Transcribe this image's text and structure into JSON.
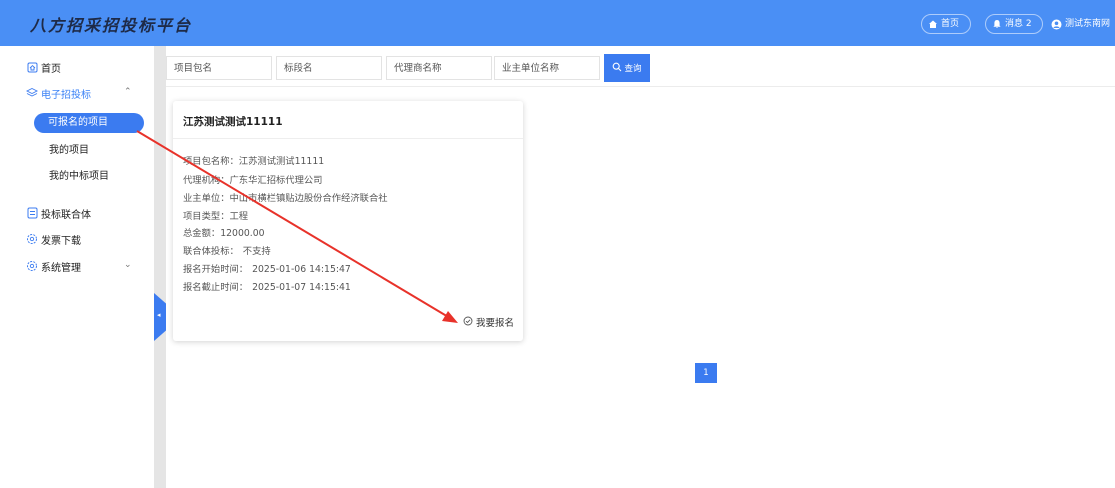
{
  "header": {
    "logo_text": "八方招采招投标平台",
    "home_label": "首页",
    "messages_label": "消息 2",
    "user_name": "测试东南网"
  },
  "sidebar": {
    "home": "首页",
    "etender": "电子招投标",
    "sub_items": [
      "可报名的项目",
      "我的项目",
      "我的中标项目"
    ],
    "consortium": "投标联合体",
    "invoice": "发票下载",
    "system": "系统管理"
  },
  "search": {
    "package_placeholder": "项目包名",
    "section_placeholder": "标段名",
    "agent_placeholder": "代理商名称",
    "owner_placeholder": "业主单位名称",
    "query_label": "查询"
  },
  "card": {
    "title": "江苏测试测试11111",
    "fields": [
      {
        "label": "项目包名称：",
        "value": "江苏测试测试11111"
      },
      {
        "label": "代理机构：",
        "value": "广东华汇招标代理公司"
      },
      {
        "label": "业主单位：",
        "value": "中山市横栏镇贴边股份合作经济联合社"
      },
      {
        "label": "项目类型：",
        "value": "工程"
      },
      {
        "label": "总金额：",
        "value": "12000.00"
      },
      {
        "label": "联合体投标：",
        "value": "不支持"
      },
      {
        "label": "报名开始时间：",
        "value": "2025-01-06 14:15:47"
      },
      {
        "label": "报名截止时间：",
        "value": "2025-01-07 14:15:41"
      }
    ],
    "signup_label": "我要报名"
  },
  "pagination": {
    "current_page": "1"
  },
  "colors": {
    "primary": "#3b7bf0",
    "header": "#4a8ff5",
    "annotation": "#e8322a"
  }
}
